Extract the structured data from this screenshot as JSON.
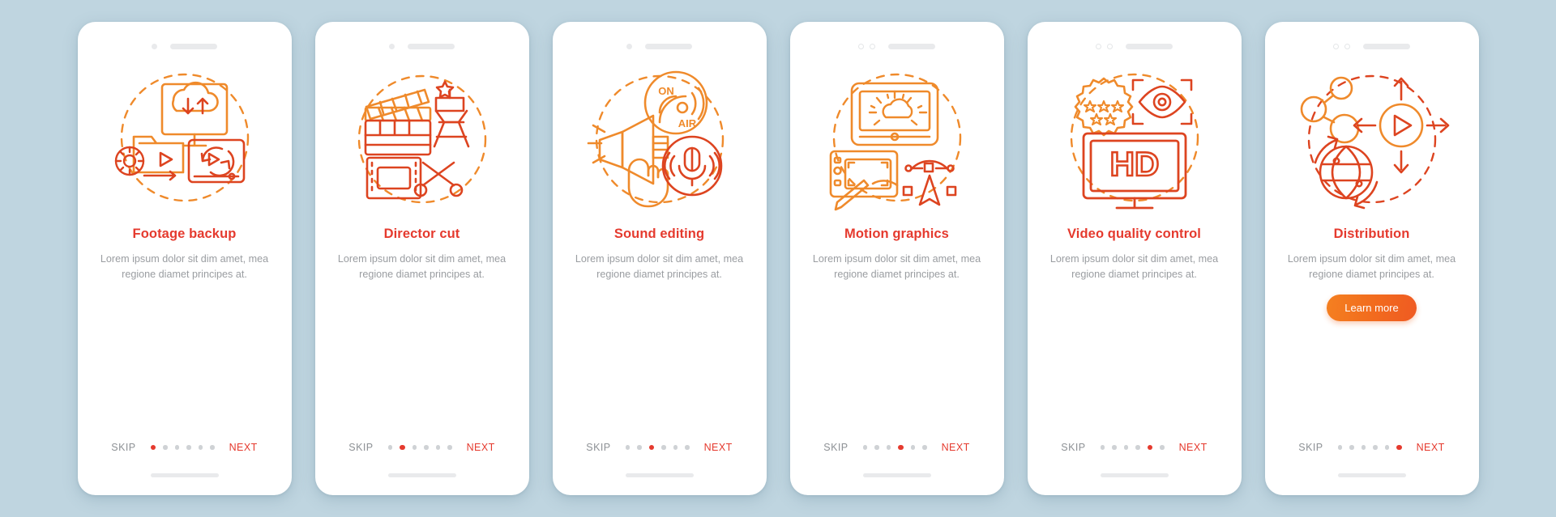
{
  "background_color": "#bfd5e0",
  "accent_color": "#e53a2e",
  "icon_color_light": "#ef8a2b",
  "icon_color_dark": "#dd4420",
  "common": {
    "skip_label": "SKIP",
    "next_label": "NEXT",
    "description": "Lorem ipsum dolor sit dim amet, mea regione diamet principes at.",
    "total_dots": 6
  },
  "screens": [
    {
      "id": "footage-backup",
      "title": "Footage backup",
      "description": "Lorem ipsum dolor sit dim amet, mea regione diamet principes at.",
      "skip_label": "SKIP",
      "next_label": "NEXT",
      "active_dot": 1,
      "camera_dots": 1,
      "cta_label": null,
      "icon_name": "cloud-backup-illustration"
    },
    {
      "id": "director-cut",
      "title": "Director cut",
      "description": "Lorem ipsum dolor sit dim amet, mea regione diamet principes at.",
      "skip_label": "SKIP",
      "next_label": "NEXT",
      "active_dot": 2,
      "camera_dots": 1,
      "cta_label": null,
      "icon_name": "clapperboard-film-illustration"
    },
    {
      "id": "sound-editing",
      "title": "Sound editing",
      "description": "Lorem ipsum dolor sit dim amet, mea regione diamet principes at.",
      "skip_label": "SKIP",
      "next_label": "NEXT",
      "active_dot": 3,
      "camera_dots": 1,
      "cta_label": null,
      "icon_name": "on-air-megaphone-microphone-illustration",
      "icon_text_on": "ON",
      "icon_text_air": "AIR"
    },
    {
      "id": "motion-graphics",
      "title": "Motion graphics",
      "description": "Lorem ipsum dolor sit dim amet, mea regione diamet principes at.",
      "skip_label": "SKIP",
      "next_label": "NEXT",
      "active_dot": 4,
      "camera_dots": 2,
      "cta_label": null,
      "icon_name": "tablet-bezier-animation-illustration"
    },
    {
      "id": "video-quality-control",
      "title": "Video quality control",
      "description": "Lorem ipsum dolor sit dim amet, mea regione diamet principes at.",
      "skip_label": "SKIP",
      "next_label": "NEXT",
      "active_dot": 5,
      "camera_dots": 2,
      "cta_label": null,
      "icon_name": "hd-monitor-stars-eye-illustration",
      "icon_text_hd": "HD"
    },
    {
      "id": "distribution",
      "title": "Distribution",
      "description": "Lorem ipsum dolor sit dim amet, mea regione diamet principes at.",
      "skip_label": "SKIP",
      "next_label": "NEXT",
      "active_dot": 6,
      "camera_dots": 2,
      "cta_label": "Learn more",
      "icon_name": "share-globe-play-illustration"
    }
  ]
}
